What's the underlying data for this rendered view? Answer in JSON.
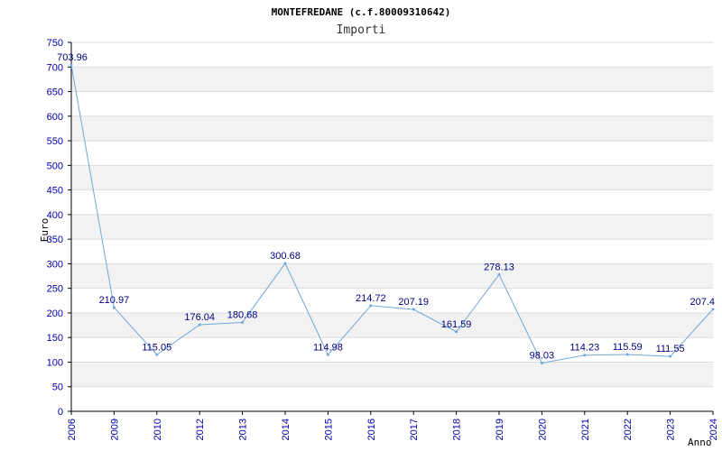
{
  "chart_data": {
    "type": "line",
    "title": "MONTEFREDANE (c.f.80009310642)",
    "subtitle": "Importi",
    "ylabel": "Euro",
    "xlabel": "Anno",
    "categories": [
      "2006",
      "2009",
      "2010",
      "2012",
      "2013",
      "2014",
      "2015",
      "2016",
      "2017",
      "2018",
      "2019",
      "2020",
      "2021",
      "2022",
      "2023",
      "2024"
    ],
    "values": [
      703.96,
      210.97,
      115.05,
      176.04,
      180.68,
      300.68,
      114.98,
      214.72,
      207.19,
      161.59,
      278.13,
      98.03,
      114.23,
      115.59,
      111.55,
      207.4
    ],
    "value_labels": [
      "703.96",
      "210.97",
      "115.05",
      "176.04",
      "180.68",
      "300.68",
      "114.98",
      "214.72",
      "207.19",
      "161.59",
      "278.13",
      "98.03",
      "114.23",
      "115.59",
      "111.55",
      "207.4"
    ],
    "ylim": [
      0,
      750
    ],
    "yticks": [
      "0",
      "50",
      "100",
      "150",
      "200",
      "250",
      "300",
      "350",
      "400",
      "450",
      "500",
      "550",
      "600",
      "650",
      "700",
      "750"
    ],
    "grid": "horizontal alternating bands",
    "colors": {
      "line": "#6fa8dc",
      "band": "#f2f2f2",
      "tick_text": "#0000aa",
      "label_text": "#000080",
      "axis": "#000000"
    }
  }
}
